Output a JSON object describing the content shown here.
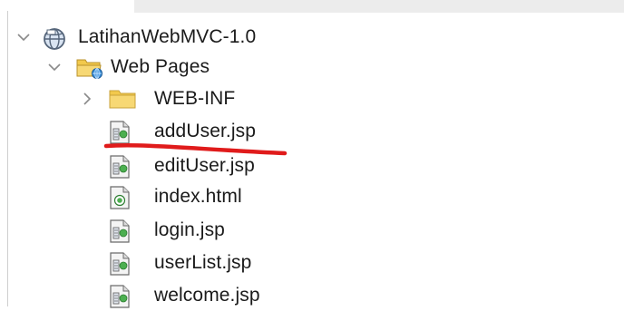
{
  "tree": {
    "project": {
      "label": "LatihanWebMVC-1.0",
      "icon": "web-project-globe-icon",
      "expanded": true
    },
    "web_pages": {
      "label": "Web Pages",
      "icon": "web-pages-folder-icon",
      "expanded": true
    },
    "web_inf": {
      "label": "WEB-INF",
      "icon": "folder-icon",
      "expanded": false
    },
    "files": [
      {
        "label": "addUser.jsp",
        "icon": "jsp-file-icon",
        "underlined": true
      },
      {
        "label": "editUser.jsp",
        "icon": "jsp-file-icon"
      },
      {
        "label": "index.html",
        "icon": "html-file-icon"
      },
      {
        "label": "login.jsp",
        "icon": "jsp-file-icon"
      },
      {
        "label": "userList.jsp",
        "icon": "jsp-file-icon"
      },
      {
        "label": "welcome.jsp",
        "icon": "jsp-file-icon"
      }
    ]
  },
  "colors": {
    "annotation_underline": "#e01b1b",
    "folder": "#f2c94c",
    "chevron": "#8a8a8a"
  }
}
